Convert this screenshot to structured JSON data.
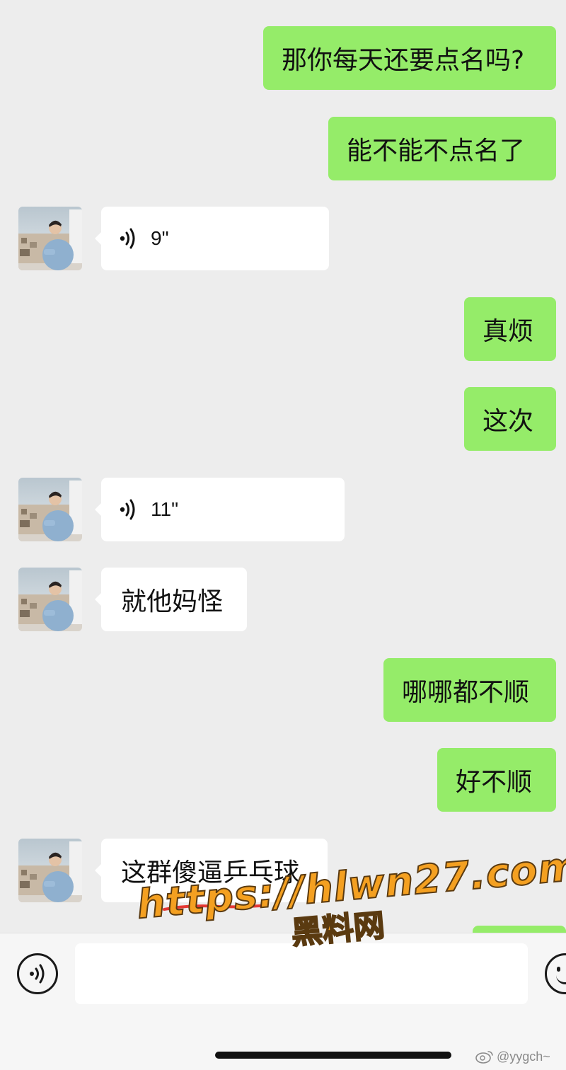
{
  "conversation": {
    "messages": [
      {
        "side": "out",
        "type": "text",
        "text": "那你每天还要点名吗?"
      },
      {
        "side": "out",
        "type": "text",
        "text": "能不能不点名了"
      },
      {
        "side": "in",
        "type": "voice",
        "text": "9\""
      },
      {
        "side": "out",
        "type": "text",
        "text": "真烦"
      },
      {
        "side": "out",
        "type": "text",
        "text": "这次"
      },
      {
        "side": "in",
        "type": "voice",
        "text": "11\""
      },
      {
        "side": "in",
        "type": "text",
        "text": "就他妈怪"
      },
      {
        "side": "out",
        "type": "text",
        "text": "哪哪都不顺"
      },
      {
        "side": "out",
        "type": "text",
        "text": "好不顺"
      },
      {
        "side": "in",
        "type": "text",
        "text": "这群傻逼乒乓球"
      }
    ]
  },
  "input_bar": {
    "voice_toggle_icon": "voice-mode-icon",
    "input_value": "",
    "emoji_icon": "emoji-icon"
  },
  "watermark": {
    "url": "https://hlwn27.com",
    "label": "黑料网"
  },
  "credit": {
    "handle": "@yygch~",
    "icon": "weibo-icon"
  },
  "colors": {
    "background": "#ededed",
    "outgoing_bubble": "#95ec69",
    "incoming_bubble": "#ffffff",
    "watermark_fill": "#f4a021",
    "underline": "#e53935"
  }
}
